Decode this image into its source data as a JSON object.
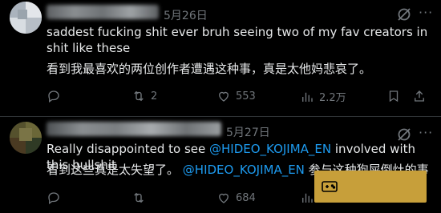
{
  "posts": [
    {
      "date": "5月26日",
      "text_line1": "saddest fucking shit ever bruh seeing two of my fav creators in shit like these",
      "text_line2": "看到我最喜欢的两位创作者遭遇这种事，真是太他妈悲哀了。",
      "stats": {
        "replies": "",
        "reposts": "2",
        "likes": "553",
        "views": "2.2万"
      }
    },
    {
      "date": "5月27日",
      "text_line1_pre": "Really disappointed to see ",
      "text_line1_mention": "@HIDEO_KOJIMA_EN",
      "text_line1_post": " involved with this bullshit",
      "text_line2_pre": "看到这些真是太失望了。",
      "text_line2_mention": "@HIDEO_KOJIMA_EN",
      "text_line2_post": " 参与这种狗屎倒灶的事",
      "stats": {
        "replies": "",
        "reposts": "",
        "likes": "684",
        "views": ""
      }
    }
  ],
  "colors": {
    "background": "#000000",
    "text": "#e7e9ea",
    "muted": "#71767b",
    "link": "#1d9bf0",
    "overlay": "#c79f3a"
  },
  "icons": [
    "grok-icon",
    "more-icon",
    "reply-icon",
    "repost-icon",
    "like-icon",
    "views-icon",
    "bookmark-icon",
    "gamepad-icon"
  ]
}
